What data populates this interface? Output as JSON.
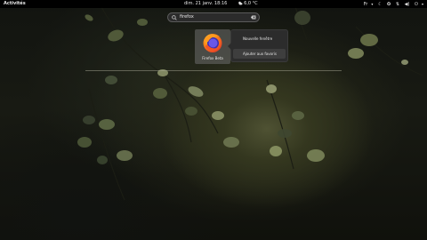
{
  "topbar": {
    "activities_label": "Activités",
    "datetime": "dim. 21 janv.  18:16",
    "temperature": "6,0 °C",
    "input_source": "Fr",
    "icons": [
      "weather-cloud-icon",
      "night-mode-icon",
      "accessibility-icon",
      "network-icon",
      "volume-icon",
      "power-icon"
    ]
  },
  "search": {
    "query": "firefox",
    "icons": [
      "search-icon",
      "clear-icon"
    ]
  },
  "results": [
    {
      "label": "Firefox Beta",
      "icon": "firefox-icon"
    }
  ],
  "context_menu": {
    "items": [
      "Nouvelle fenêtre",
      "Ajouter aux favoris"
    ]
  },
  "colors": {
    "topbar": "#000000",
    "menu_bg": "#2c2c2c",
    "menu_highlight": "#3e3e3e",
    "text": "#e6e6e6"
  }
}
